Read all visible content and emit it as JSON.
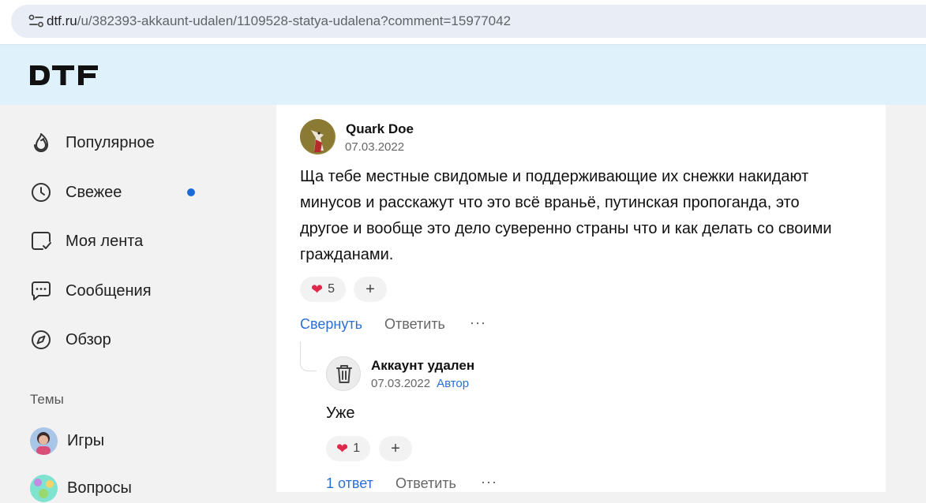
{
  "browser": {
    "url_domain": "dtf.ru",
    "url_path": "/u/382393-akkaunt-udalen/1109528-statya-udalena?comment=15977042",
    "site_info_icon": "tune-icon"
  },
  "header": {
    "logo_text": "DTF",
    "background": "#dff1fb"
  },
  "sidebar": {
    "nav": [
      {
        "label": "Популярное",
        "icon": "flame-icon"
      },
      {
        "label": "Свежее",
        "icon": "clock-icon",
        "has_new": true
      },
      {
        "label": "Моя лента",
        "icon": "feed-icon"
      },
      {
        "label": "Сообщения",
        "icon": "chat-icon"
      },
      {
        "label": "Обзор",
        "icon": "compass-icon"
      }
    ],
    "topics_title": "Темы",
    "topics": [
      {
        "label": "Игры"
      },
      {
        "label": "Вопросы"
      }
    ]
  },
  "comments": [
    {
      "author": "Quark Doe",
      "date": "07.03.2022",
      "text": "Ща тебе местные свидомые и поддерживающие их снежки накидают минусов и расскажут что это всё враньё, путинская пропоганда, это другое и вообще это дело суверенно страны что и как делать со своими гражданами.",
      "reaction_icon": "heart-icon",
      "reaction_count": "5",
      "add_reaction": "+",
      "collapse_label": "Свернуть",
      "reply_label": "Ответить",
      "more_label": "···"
    },
    {
      "author": "Аккаунт удален",
      "date": "07.03.2022",
      "badge": "Автор",
      "text": "Уже",
      "reaction_icon": "heart-icon",
      "reaction_count": "1",
      "add_reaction": "+",
      "replies_label": "1 ответ",
      "reply_label": "Ответить",
      "more_label": "···"
    }
  ],
  "colors": {
    "accent": "#2a6fd6",
    "heart": "#e0294a",
    "new_dot": "#1a6bd9"
  }
}
